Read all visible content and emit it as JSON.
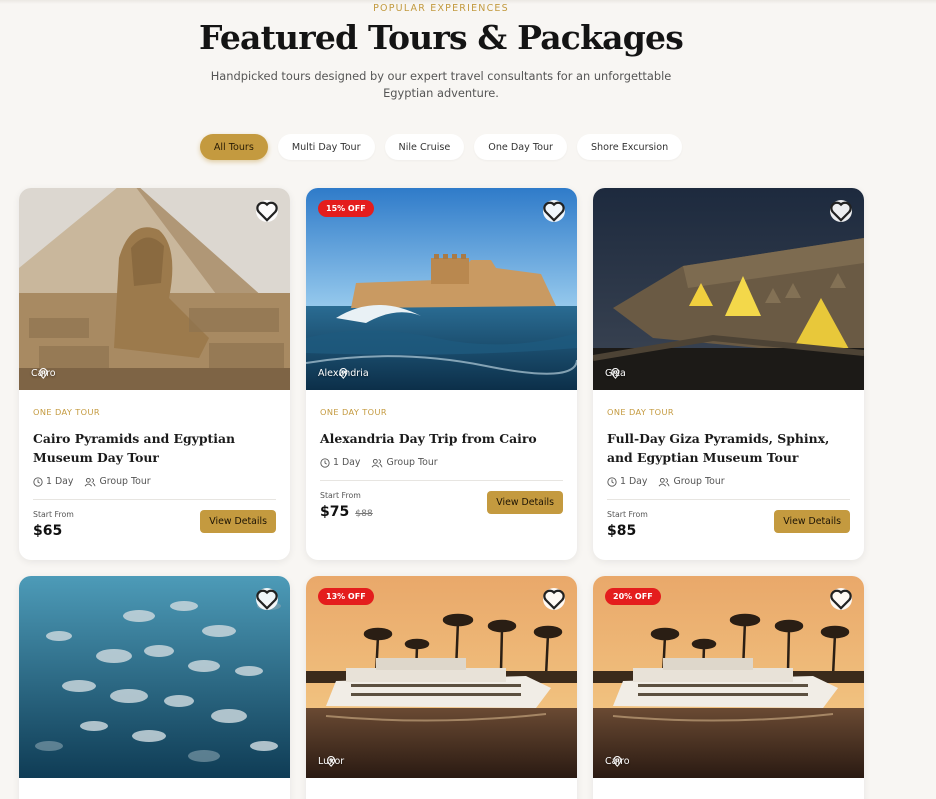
{
  "header": {
    "eyebrow": "POPULAR EXPERIENCES",
    "title": "Featured Tours & Packages",
    "subtitle": "Handpicked tours designed by our expert travel consultants for an unforgettable Egyptian adventure."
  },
  "filters": {
    "active": "All Tours",
    "items": [
      "All Tours",
      "Multi Day Tour",
      "Nile Cruise",
      "One Day Tour",
      "Shore Excursion"
    ]
  },
  "colors": {
    "accent": "#c49a3f",
    "badge": "#e41d1d",
    "background": "#f8f6f3"
  },
  "cards": [
    {
      "image": "sphinx-pyramid-photo",
      "location": "Cairo",
      "badge": "",
      "category": "ONE DAY TOUR",
      "title": "Cairo Pyramids and Egyptian Museum Day Tour",
      "duration": "1 Day",
      "group": "Group Tour",
      "start_label": "Start From",
      "price": "$65",
      "old_price": "",
      "button": "View Details"
    },
    {
      "image": "citadel-sea-photo",
      "location": "Alexandria",
      "badge": "15% OFF",
      "category": "ONE DAY TOUR",
      "title": "Alexandria Day Trip from Cairo",
      "duration": "1 Day",
      "group": "Group Tour",
      "start_label": "Start From",
      "price": "$75",
      "old_price": "$88",
      "button": "View Details"
    },
    {
      "image": "museum-night-photo",
      "location": "Giza",
      "badge": "",
      "category": "ONE DAY TOUR",
      "title": "Full-Day Giza Pyramids, Sphinx, and Egyptian Museum Tour",
      "duration": "1 Day",
      "group": "Group Tour",
      "start_label": "Start From",
      "price": "$85",
      "old_price": "",
      "button": "View Details"
    },
    {
      "image": "fish-school-photo",
      "location": "",
      "badge": ""
    },
    {
      "image": "nile-cruise-sunset-photo",
      "location": "Luxor",
      "badge": "13% OFF"
    },
    {
      "image": "nile-cruise-sunset-photo",
      "location": "Cairo",
      "badge": "20% OFF"
    }
  ]
}
